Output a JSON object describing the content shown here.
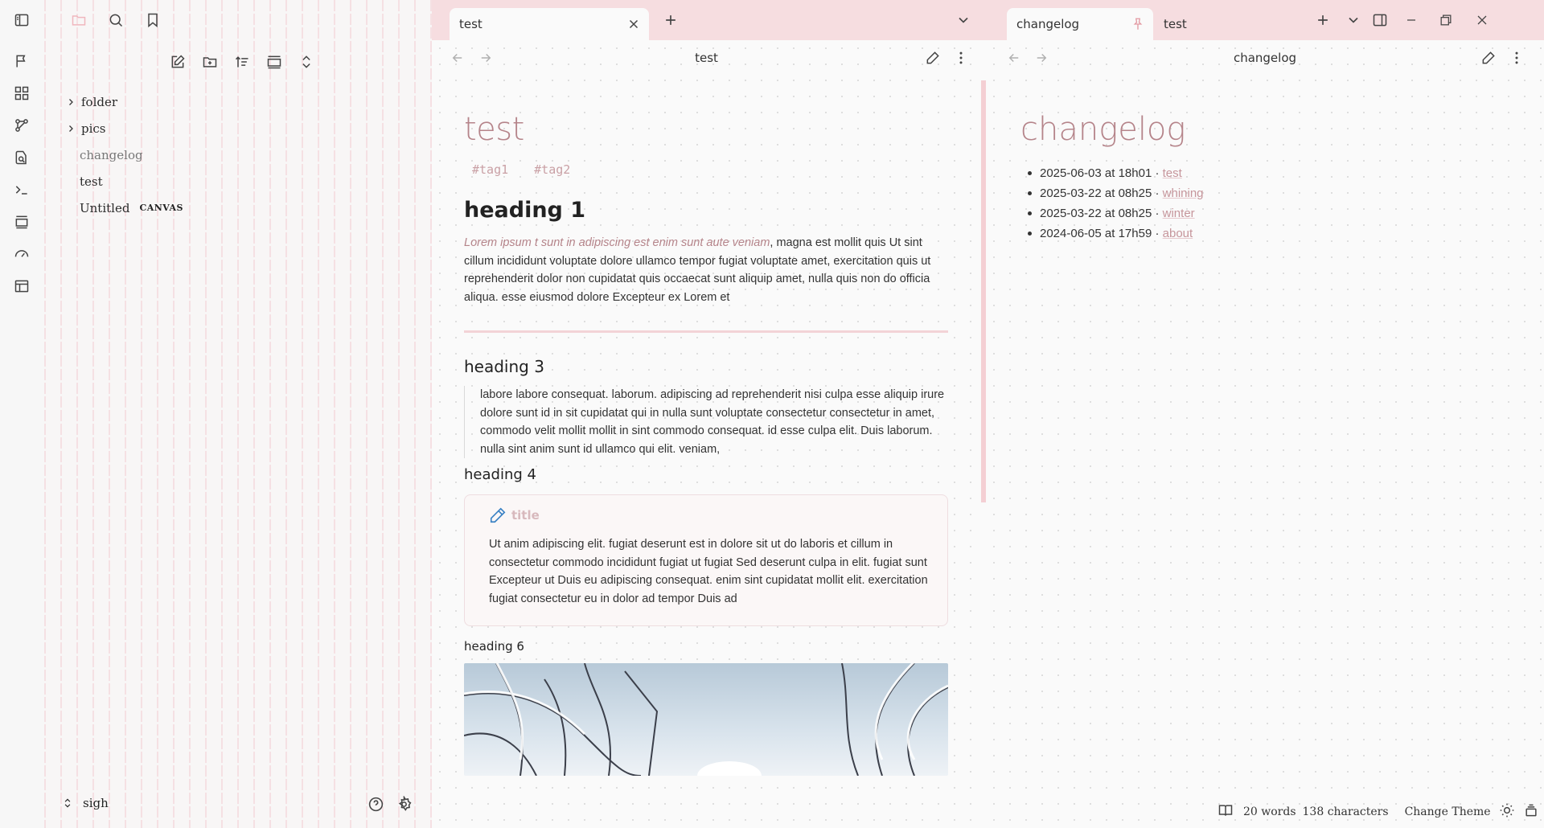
{
  "sidebar": {
    "tree": [
      {
        "label": "folder",
        "type": "folder"
      },
      {
        "label": "pics",
        "type": "folder"
      },
      {
        "label": "changelog",
        "type": "file"
      },
      {
        "label": "test",
        "type": "file"
      },
      {
        "label": "Untitled",
        "type": "canvas",
        "badge": "CANVAS"
      }
    ],
    "vault_name": "sigh"
  },
  "tabs_left": [
    {
      "label": "test"
    }
  ],
  "tabs_right": [
    {
      "label": "changelog",
      "pinned": true
    },
    {
      "label": "test"
    }
  ],
  "left_pane": {
    "header_title": "test",
    "doc_title": "test",
    "tags": [
      "#tag1",
      "#tag2"
    ],
    "heading1": "heading 1",
    "para1_italic": "Lorem ipsum t sunt in adipiscing est enim sunt aute veniam",
    "para1_rest": ", magna est mollit quis Ut sint cillum incididunt voluptate dolore ullamco tempor fugiat voluptate amet, exercitation quis ut reprehenderit dolor non cupidatat quis occaecat sunt aliquip amet, nulla quis non do officia aliqua. esse eiusmod dolore Excepteur ex Lorem et",
    "heading3": "heading 3",
    "quote": "labore labore consequat. laborum. adipiscing ad reprehenderit nisi culpa esse aliquip irure dolore sunt id in sit cupidatat qui in nulla sunt voluptate consectetur consectetur in amet, commodo velit mollit mollit in sint commodo consequat. id esse culpa elit. Duis laborum. nulla sint anim sunt id ullamco qui elit. veniam,",
    "heading4": "heading 4",
    "callout_title": "title",
    "callout_body": "Ut anim adipiscing elit. fugiat deserunt est in dolore sit ut do laboris et cillum in consectetur commodo incididunt fugiat ut fugiat Sed deserunt culpa in elit. fugiat sunt Excepteur ut Duis eu adipiscing consequat. enim sint cupidatat mollit elit. exercitation fugiat consectetur eu in dolor ad tempor Duis ad",
    "heading6": "heading 6"
  },
  "right_pane": {
    "header_title": "changelog",
    "doc_title": "changelog",
    "entries": [
      {
        "date": "2025-06-03 at 18h01",
        "link": "test"
      },
      {
        "date": "2025-03-22 at 08h25",
        "link": "whining"
      },
      {
        "date": "2025-03-22 at 08h25",
        "link": "winter"
      },
      {
        "date": "2024-06-05 at 17h59",
        "link": "about"
      }
    ],
    "separator": " · "
  },
  "status": {
    "words": "20 words",
    "characters": "138 characters",
    "change_theme": "Change Theme"
  },
  "colors": {
    "accent": "#b5848a",
    "tab_bar": "#f6dde0",
    "link": "#c6959b",
    "callout_icon": "#3b82c4"
  }
}
